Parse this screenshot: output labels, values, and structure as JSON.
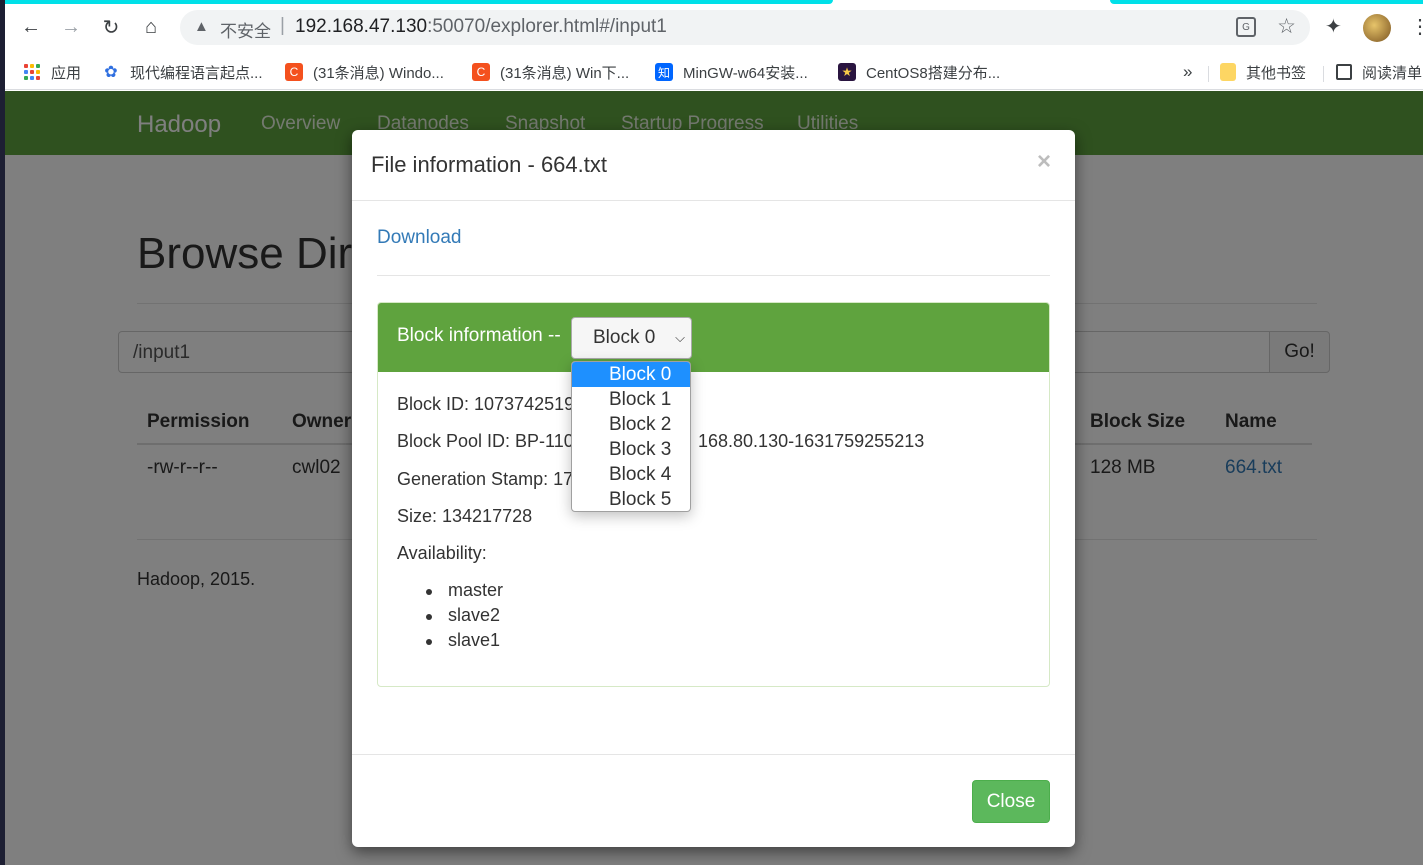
{
  "browser": {
    "insecure_label": "不安全",
    "separator": "|",
    "url_main": "192.168.47.130",
    "url_rest": ":50070/explorer.html#/input1",
    "bookmarks": [
      {
        "label": "应用",
        "icon": "apps-grid-icon"
      },
      {
        "label": "现代编程语言起点...",
        "icon": "baidu-paw-icon"
      },
      {
        "label": "(31条消息) Windo...",
        "icon": "csdn-icon"
      },
      {
        "label": "(31条消息) Win下...",
        "icon": "csdn-icon"
      },
      {
        "label": "MinGW-w64安装...",
        "icon": "zhihu-icon"
      },
      {
        "label": "CentOS8搭建分布...",
        "icon": "site-icon"
      }
    ],
    "overflow": "»",
    "other_bookmarks": "其他书签",
    "reading_list": "阅读清单"
  },
  "navbar": {
    "brand": "Hadoop",
    "links": [
      "Overview",
      "Datanodes",
      "Snapshot",
      "Startup Progress",
      "Utilities"
    ]
  },
  "page": {
    "title": "Browse Directory",
    "path": "/input1",
    "go": "Go!",
    "table": {
      "headers": [
        "Permission",
        "Owner",
        "Block Size",
        "Name"
      ],
      "row": {
        "permission": "-rw-r--r--",
        "owner": "cwl02",
        "block_size": "128 MB",
        "name": "664.txt"
      }
    },
    "footer": "Hadoop, 2015."
  },
  "modal": {
    "title": "File information - 664.txt",
    "close_x": "×",
    "download": "Download",
    "panel_title": "Block information --",
    "selected_block": "Block 0",
    "block_options": [
      "Block 0",
      "Block 1",
      "Block 2",
      "Block 3",
      "Block 4",
      "Block 5"
    ],
    "block_id": "Block ID: 1073742519",
    "block_pool_id": "Block Pool ID: BP-110",
    "block_pool_id_tail": "168.80.130-1631759255213",
    "generation_stamp": "Generation Stamp: 17",
    "size": "Size: 134217728",
    "availability_label": "Availability:",
    "availability": [
      "master",
      "slave2",
      "slave1"
    ],
    "close_button": "Close"
  },
  "colors": {
    "hadoop_green": "#5fa33e",
    "close_green": "#5cb85c",
    "link_blue": "#337ab7",
    "dropdown_highlight": "#1e90ff"
  }
}
